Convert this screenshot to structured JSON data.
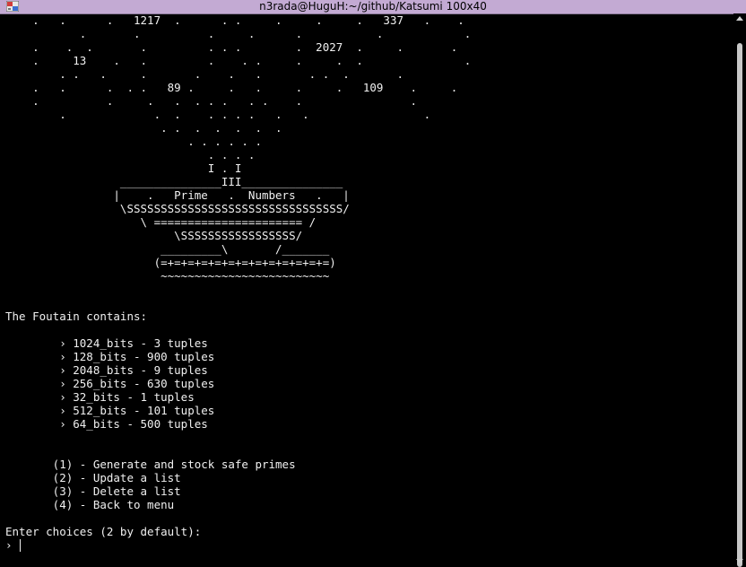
{
  "window": {
    "title": "n3rada@HuguH:~/github/Katsumi 100x40"
  },
  "terminal": {
    "fountain_lines": [
      "    .   .      .   1217  .      . .     .     .     .   337   .    .",
      "           .       .          .     .      .           .            .",
      "    .    .  .       .         . . .        .  2027  .     .       .",
      "    .     13    .   .         .    . .     .     .  .               .",
      "        . .   .     .       .    .   .       . .  .       .",
      "    .   .      .  . .   89 .     .   .     .     .   109    .     .",
      "    .          .     .   .  . . .   . .    .                .",
      "        .             .  .    . . . .   .   .                 .",
      "                       . .  .  .  .  .  .",
      "                           . . . . . .",
      "                              . . . .",
      "                              I . I",
      "                 _______________III_______________",
      "                |    .   Prime   .  Numbers   .   |",
      "                 \\SSSSSSSSSSSSSSSSSSSSSSSSSSSSSSSS/",
      "                    \\ ====================== /",
      "                         \\SSSSSSSSSSSSSSSSS/",
      "                       _________\\       /_______",
      "                      (=+=+=+=+=+=+=+=+=+=+=+=+=)",
      "                       ~~~~~~~~~~~~~~~~~~~~~~~~~"
    ],
    "contains_header": "The Foutain contains:",
    "tuple_items": [
      "        › 1024_bits - 3 tuples",
      "        › 128_bits - 900 tuples",
      "        › 2048_bits - 9 tuples",
      "        › 256_bits - 630 tuples",
      "        › 32_bits - 1 tuples",
      "        › 512_bits - 101 tuples",
      "        › 64_bits - 500 tuples"
    ],
    "menu_options": [
      "       (1) - Generate and stock safe primes",
      "       (2) - Update a list",
      "       (3) - Delete a list",
      "       (4) - Back to menu"
    ],
    "prompt_text": "Enter choices (2 by default):",
    "input_prefix": "›",
    "input_value": ""
  }
}
